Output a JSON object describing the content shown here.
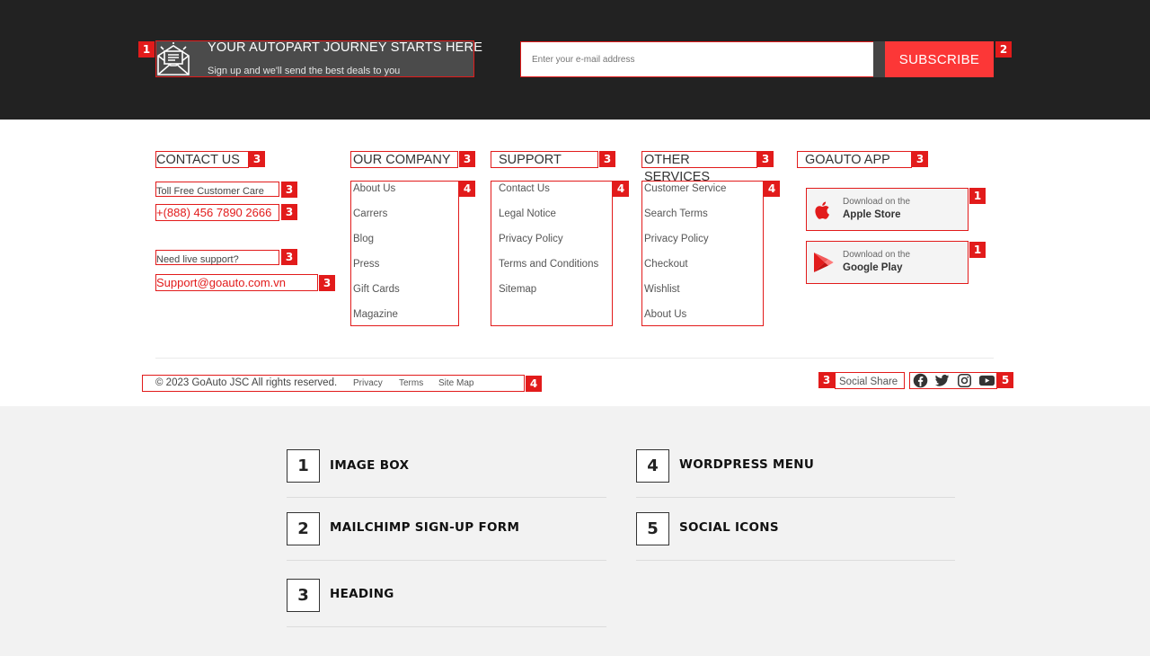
{
  "newsletter": {
    "title": "YOUR AUTOPART JOURNEY STARTS HERE",
    "subtitle": "Sign up and we'll send the best deals to you",
    "icon": "envelope-newsletter-icon",
    "email_placeholder": "Enter your e-mail address",
    "subscribe_label": "SUBSCRIBE"
  },
  "contact": {
    "heading": "CONTACT US",
    "toll_free_label": "Toll Free Customer Care",
    "phone": "+(888) 456 7890 2666",
    "support_label": "Need live support?",
    "email": "Support@goauto.com.vn"
  },
  "company": {
    "heading": "OUR COMPANY",
    "links": [
      "About Us",
      "Carrers",
      "Blog",
      "Press",
      "Gift Cards",
      "Magazine"
    ]
  },
  "support": {
    "heading": "SUPPORT",
    "links": [
      "Contact Us",
      "Legal Notice",
      "Privacy Policy",
      "Terms and Conditions",
      "Sitemap"
    ]
  },
  "services": {
    "heading": "OTHER SERVICES",
    "links": [
      "Customer Service",
      "Search Terms",
      "Privacy Policy",
      "Checkout",
      "Wishlist",
      "About Us"
    ]
  },
  "app": {
    "heading": "GOAUTO APP",
    "apple_small": "Download on the",
    "apple_big": "Apple Store",
    "google_small": "Download on the",
    "google_big": "Google Play"
  },
  "bottom": {
    "copyright": "© 2023 GoAuto JSC All rights reserved.",
    "links": [
      "Privacy",
      "Terms",
      "Site Map"
    ],
    "social_label": "Social Share",
    "social_icons": [
      "facebook-icon",
      "twitter-icon",
      "instagram-icon",
      "youtube-icon"
    ]
  },
  "badges": {
    "b1": "1",
    "b2": "2",
    "b3": "3",
    "b4": "4",
    "b5": "5"
  },
  "legend": [
    {
      "num": "1",
      "label": "IMAGE BOX"
    },
    {
      "num": "2",
      "label": "MAILCHIMP SIGN-UP FORM"
    },
    {
      "num": "3",
      "label": "HEADING"
    },
    {
      "num": "4",
      "label": "WORDPRESS MENU"
    },
    {
      "num": "5",
      "label": "SOCIAL ICONS"
    }
  ],
  "colors": {
    "accent": "#e21b1b",
    "subscribe": "#fc3737",
    "dark_band": "#222222"
  }
}
